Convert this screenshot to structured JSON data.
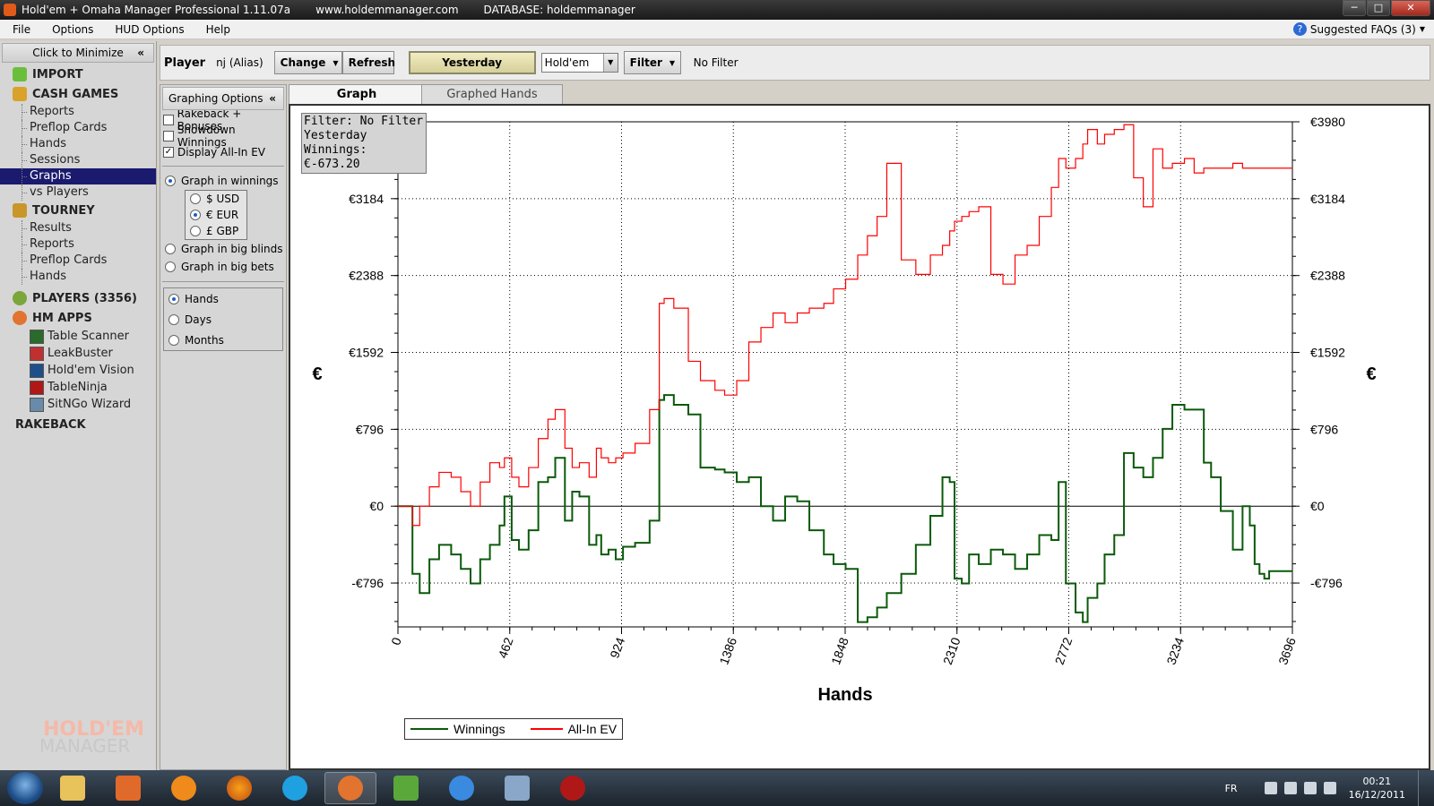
{
  "titlebar": {
    "title": "Hold'em + Omaha Manager Professional 1.11.07a",
    "site": "www.holdemmanager.com",
    "database": "DATABASE: holdemmanager",
    "min": "─",
    "max": "□",
    "close": "✕"
  },
  "menu": {
    "items": [
      "File",
      "Options",
      "HUD Options",
      "Help"
    ],
    "faq": "Suggested FAQs (3)",
    "faq_icon": "?"
  },
  "leftnav": {
    "minimize_label": "Click to Minimize",
    "collapse_glyph": "«",
    "import_label": "IMPORT",
    "cash_label": "CASH GAMES",
    "cash_items": [
      "Reports",
      "Preflop Cards",
      "Hands",
      "Sessions",
      "Graphs",
      "vs Players"
    ],
    "tourney_label": "TOURNEY",
    "tourney_items": [
      "Results",
      "Reports",
      "Preflop Cards",
      "Hands"
    ],
    "players_label": "PLAYERS (3356)",
    "hmapps_label": "HM APPS",
    "apps": [
      "Table Scanner",
      "LeakBuster",
      "Hold'em Vision",
      "TableNinja",
      "SitNGo Wizard"
    ],
    "rakeback_label": "RAKEBACK",
    "logo_line1": "HOLD'EM",
    "logo_line2": "MANAGER"
  },
  "toolbar": {
    "player_label": "Player",
    "alias": "nj (Alias)",
    "change": "Change",
    "refresh": "Refresh",
    "period": "Yesterday",
    "game": "Hold'em",
    "filter": "Filter",
    "filter_status": "No Filter"
  },
  "graph_options": {
    "header": "Graphing Options",
    "collapse_glyph": "«",
    "rakeback": "Rakeback + Bonuses",
    "showdown": "Showdown Winnings",
    "allin": "Display All-In EV",
    "in_winnings": "Graph in winnings",
    "usd": "$ USD",
    "eur": "€ EUR",
    "gbp": "£ GBP",
    "big_blinds": "Graph in big blinds",
    "big_bets": "Graph in big bets",
    "hands": "Hands",
    "days": "Days",
    "months": "Months",
    "check": "✓"
  },
  "tabs": {
    "graph": "Graph",
    "graphed_hands": "Graphed Hands"
  },
  "infobox": {
    "line1": "Filter: No Filter",
    "line2": "Yesterday",
    "line3": "Winnings: €-673.20"
  },
  "chart_data": {
    "type": "line",
    "xlabel": "Hands",
    "ylabel": "€",
    "xlim": [
      0,
      3696
    ],
    "ylim": [
      -1250,
      3980
    ],
    "x_ticks": [
      0,
      462,
      924,
      1386,
      1848,
      2310,
      2772,
      3234,
      3696
    ],
    "y_ticks": [
      {
        "value": 3980,
        "label": "€3980"
      },
      {
        "value": 3184,
        "label": "€3184"
      },
      {
        "value": 2388,
        "label": "€2388"
      },
      {
        "value": 1592,
        "label": "€1592"
      },
      {
        "value": 796,
        "label": "€796"
      },
      {
        "value": 0,
        "label": "€0"
      },
      {
        "value": -796,
        "label": "-€796"
      }
    ],
    "grid": true,
    "legend": "bottom-left",
    "series": [
      {
        "name": "Winnings",
        "color": "#0a5a0a",
        "x": [
          0,
          40,
          60,
          90,
          130,
          170,
          220,
          260,
          300,
          340,
          380,
          420,
          440,
          470,
          500,
          540,
          580,
          620,
          650,
          690,
          720,
          750,
          790,
          820,
          840,
          870,
          900,
          930,
          980,
          1040,
          1080,
          1100,
          1140,
          1200,
          1250,
          1310,
          1350,
          1400,
          1450,
          1500,
          1550,
          1600,
          1650,
          1700,
          1760,
          1800,
          1850,
          1900,
          1940,
          1980,
          2020,
          2080,
          2140,
          2200,
          2250,
          2280,
          2300,
          2330,
          2360,
          2400,
          2450,
          2500,
          2550,
          2600,
          2650,
          2700,
          2730,
          2760,
          2800,
          2830,
          2850,
          2890,
          2920,
          2960,
          3000,
          3040,
          3080,
          3120,
          3160,
          3200,
          3250,
          3290,
          3330,
          3360,
          3400,
          3450,
          3490,
          3520,
          3540,
          3560,
          3580,
          3600,
          3650,
          3680,
          3696
        ],
        "y": [
          0,
          0,
          -700,
          -900,
          -550,
          -400,
          -500,
          -650,
          -800,
          -550,
          -400,
          -200,
          100,
          -350,
          -450,
          -250,
          250,
          300,
          500,
          -150,
          150,
          100,
          -400,
          -300,
          -500,
          -450,
          -550,
          -420,
          -380,
          -150,
          1100,
          1150,
          1050,
          950,
          400,
          380,
          350,
          250,
          300,
          0,
          -150,
          100,
          50,
          -250,
          -500,
          -600,
          -650,
          -1200,
          -1150,
          -1050,
          -900,
          -700,
          -400,
          -100,
          300,
          250,
          -750,
          -800,
          -500,
          -600,
          -450,
          -500,
          -650,
          -500,
          -300,
          -350,
          250,
          -800,
          -1100,
          -1200,
          -950,
          -800,
          -500,
          -300,
          550,
          400,
          300,
          500,
          800,
          1050,
          1000,
          1000,
          450,
          300,
          -50,
          -450,
          0,
          -200,
          -600,
          -700,
          -750,
          -673,
          -673,
          -673,
          -673
        ]
      },
      {
        "name": "All-In EV",
        "color": "#ff0000",
        "x": [
          0,
          40,
          60,
          90,
          130,
          170,
          220,
          260,
          300,
          340,
          380,
          420,
          440,
          470,
          500,
          540,
          580,
          620,
          650,
          690,
          720,
          750,
          790,
          820,
          840,
          870,
          900,
          930,
          980,
          1040,
          1080,
          1100,
          1140,
          1200,
          1250,
          1310,
          1350,
          1400,
          1450,
          1500,
          1550,
          1600,
          1650,
          1700,
          1760,
          1800,
          1850,
          1900,
          1940,
          1980,
          2020,
          2080,
          2140,
          2200,
          2250,
          2280,
          2300,
          2330,
          2360,
          2400,
          2450,
          2500,
          2550,
          2600,
          2650,
          2700,
          2730,
          2760,
          2800,
          2830,
          2850,
          2890,
          2920,
          2960,
          3000,
          3040,
          3080,
          3120,
          3160,
          3200,
          3250,
          3290,
          3330,
          3360,
          3400,
          3450,
          3490,
          3520,
          3540,
          3560,
          3580,
          3600,
          3650,
          3680,
          3696
        ],
        "y": [
          0,
          0,
          -200,
          0,
          200,
          350,
          300,
          150,
          0,
          250,
          450,
          400,
          500,
          300,
          200,
          400,
          700,
          900,
          1000,
          600,
          400,
          450,
          300,
          600,
          500,
          450,
          500,
          550,
          650,
          1000,
          2100,
          2150,
          2050,
          1500,
          1300,
          1200,
          1150,
          1300,
          1700,
          1850,
          2000,
          1900,
          2000,
          2050,
          2100,
          2250,
          2350,
          2600,
          2800,
          3000,
          3550,
          2550,
          2400,
          2600,
          2700,
          2850,
          2950,
          3000,
          3050,
          3100,
          2400,
          2300,
          2600,
          2700,
          3000,
          3300,
          3600,
          3500,
          3600,
          3750,
          3900,
          3750,
          3850,
          3900,
          3950,
          3400,
          3100,
          3700,
          3500,
          3550,
          3600,
          3450,
          3500,
          3500,
          3500,
          3550,
          3500,
          3500,
          3500,
          3500,
          3500,
          3500,
          3500,
          3500,
          3500
        ]
      }
    ]
  },
  "taskbar": {
    "lang": "FR",
    "time": "00:21",
    "date": "16/12/2011"
  }
}
